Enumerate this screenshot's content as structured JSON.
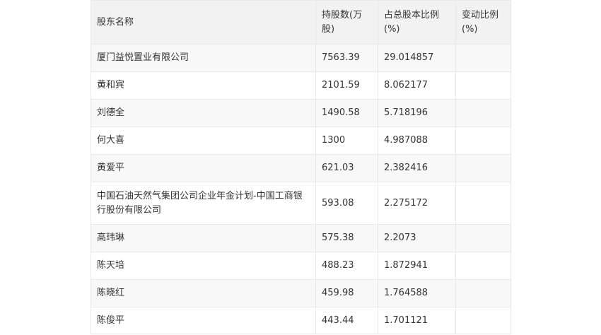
{
  "table": {
    "headers": [
      "股东名称",
      "持股数(万股)",
      "占总股本比例(%)",
      "变动比例(%)"
    ],
    "rows": [
      [
        "厦门益悦置业有限公司",
        "7563.39",
        "29.014857",
        ""
      ],
      [
        "黄和宾",
        "2101.59",
        "8.062177",
        ""
      ],
      [
        "刘德全",
        "1490.58",
        "5.718196",
        ""
      ],
      [
        "何大喜",
        "1300",
        "4.987088",
        ""
      ],
      [
        "黄爱平",
        "621.03",
        "2.382416",
        ""
      ],
      [
        "中国石油天然气集团公司企业年金计划-中国工商银行股份有限公司",
        "593.08",
        "2.275172",
        ""
      ],
      [
        "高玮琳",
        "575.38",
        "2.2073",
        ""
      ],
      [
        "陈天培",
        "488.23",
        "1.872941",
        ""
      ],
      [
        "陈晓红",
        "459.98",
        "1.764588",
        ""
      ],
      [
        "陈俊平",
        "443.44",
        "1.701121",
        ""
      ]
    ]
  }
}
